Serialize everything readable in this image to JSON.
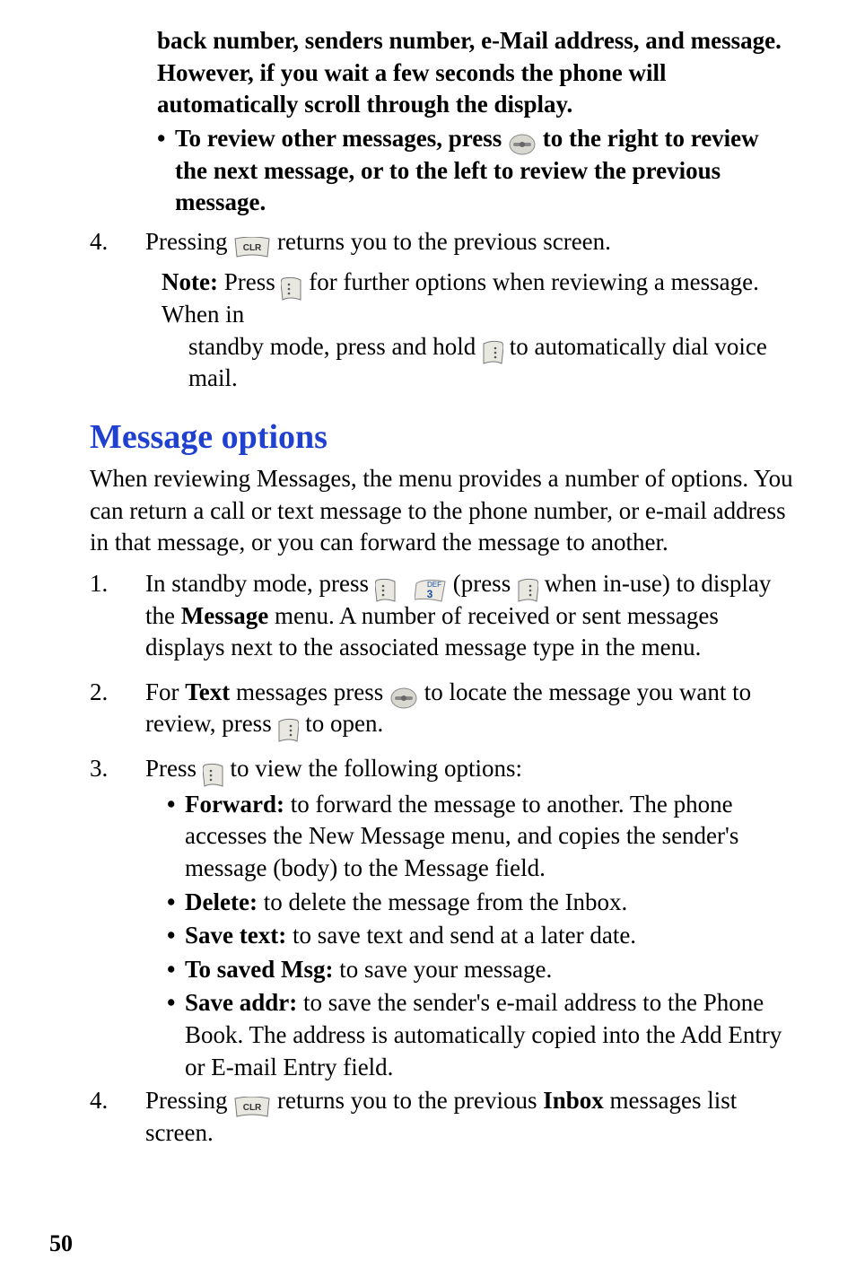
{
  "top": {
    "cont1": "back number, senders number, e-Mail address, and message. However, if you wait a few seconds the phone will automatically scroll through the display.",
    "bullet_pre": "To review other messages, press",
    "bullet_post": "to the right to review the next message, or to the left to review the previous message.",
    "step4_num": "4.",
    "step4_a": "Pressing ",
    "step4_b": " returns you to the previous screen.",
    "note_label": "Note:",
    "note_a": " Press ",
    "note_b": " for further options when reviewing a message. When in",
    "note_c": "standby mode, press and hold ",
    "note_d": " to automatically dial voice mail."
  },
  "h2": "Message options",
  "intro": "When reviewing Messages, the menu provides a number of options. You can return a call or text message to the phone number, or e-mail address in that message, or you can forward the message to another.",
  "s1": {
    "num": "1.",
    "a": "In standby mode, press ",
    "b": " (press ",
    "c": " when in-use) to display the ",
    "d": "Message",
    "e": " menu. A number of received or sent messages displays next to the associated message type in the menu."
  },
  "s2": {
    "num": "2.",
    "a": "For ",
    "b": "Text",
    "c": " messages press",
    "d": "to locate the message you want to review, press ",
    "e": " to open."
  },
  "s3": {
    "num": "3.",
    "a": "Press ",
    "b": " to view the following options:"
  },
  "opts": {
    "fwd_l": "Forward:",
    "fwd_t": " to forward the message to another. The phone accesses the New Message menu, and copies the sender's message (body) to the Message field.",
    "del_l": "Delete:",
    "del_t": " to delete the message from the Inbox.",
    "sav_l": "Save text:",
    "sav_t": " to save text and send at a later date.",
    "tsm_l": "To saved Msg:",
    "tsm_t": " to save your message.",
    "sad_l": "Save addr:",
    "sad_t": " to save the sender's e-mail address to the Phone Book. The address is automatically copied into the Add Entry or E-mail Entry field."
  },
  "s4": {
    "num": "4.",
    "a": "Pressing ",
    "b": " returns you to the previous ",
    "c": "Inbox",
    "d": " messages list screen."
  },
  "page_number": "50"
}
